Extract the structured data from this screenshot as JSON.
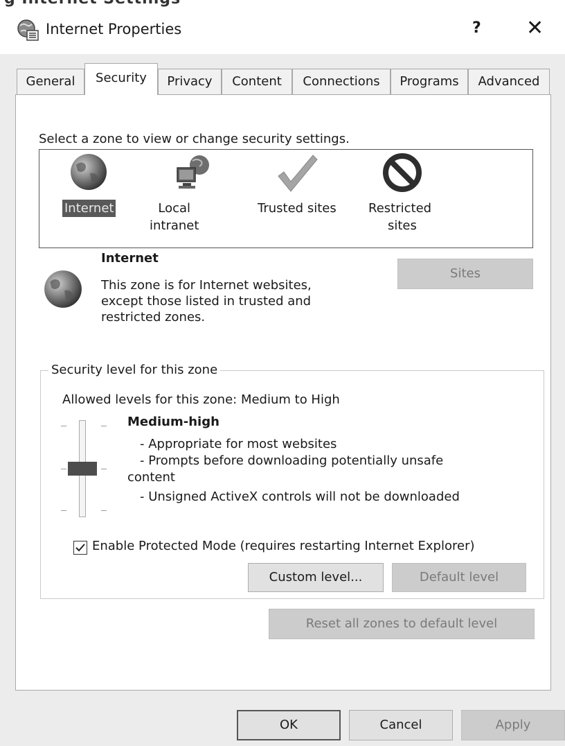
{
  "window": {
    "header_fragment": "g Internet Settings",
    "title": "Internet Properties",
    "help_label": "?",
    "close_label": "✕"
  },
  "tabs": [
    {
      "label": "General",
      "active": false
    },
    {
      "label": "Security",
      "active": true
    },
    {
      "label": "Privacy",
      "active": false
    },
    {
      "label": "Content",
      "active": false
    },
    {
      "label": "Connections",
      "active": false
    },
    {
      "label": "Programs",
      "active": false
    },
    {
      "label": "Advanced",
      "active": false
    }
  ],
  "security": {
    "zone_prompt": "Select a zone to view or change security settings.",
    "zones": [
      {
        "label": "Internet",
        "icon": "globe-icon",
        "selected": true
      },
      {
        "label": "Local intranet",
        "icon": "intranet-icon",
        "selected": false
      },
      {
        "label": "Trusted sites",
        "icon": "checkmark-icon",
        "selected": false
      },
      {
        "label_line1": "Restricted",
        "label_line2": "sites",
        "icon": "restricted-icon",
        "selected": false
      }
    ],
    "zone_info": {
      "name": "Internet",
      "desc_line1": "This zone is for Internet websites,",
      "desc_line2": "except those listed in trusted and",
      "desc_line3": "restricted zones."
    },
    "sites_button": "Sites",
    "level_group": {
      "title": "Security level for this zone",
      "allowed": "Allowed levels for this zone: Medium to High",
      "level_name": "Medium-high",
      "slider_level": "Medium-high",
      "desc_line1": "- Appropriate for most websites",
      "desc_line2": "- Prompts before downloading potentially unsafe",
      "desc_line3": "content",
      "desc_line4": "- Unsigned ActiveX controls will not be downloaded",
      "protected_mode_label": "Enable Protected Mode (requires restarting Internet Explorer)",
      "protected_mode_checked": true,
      "custom_level_button": "Custom level...",
      "default_level_button": "Default level"
    },
    "reset_button": "Reset all zones to default level"
  },
  "footer": {
    "ok": "OK",
    "cancel": "Cancel",
    "apply": "Apply"
  }
}
